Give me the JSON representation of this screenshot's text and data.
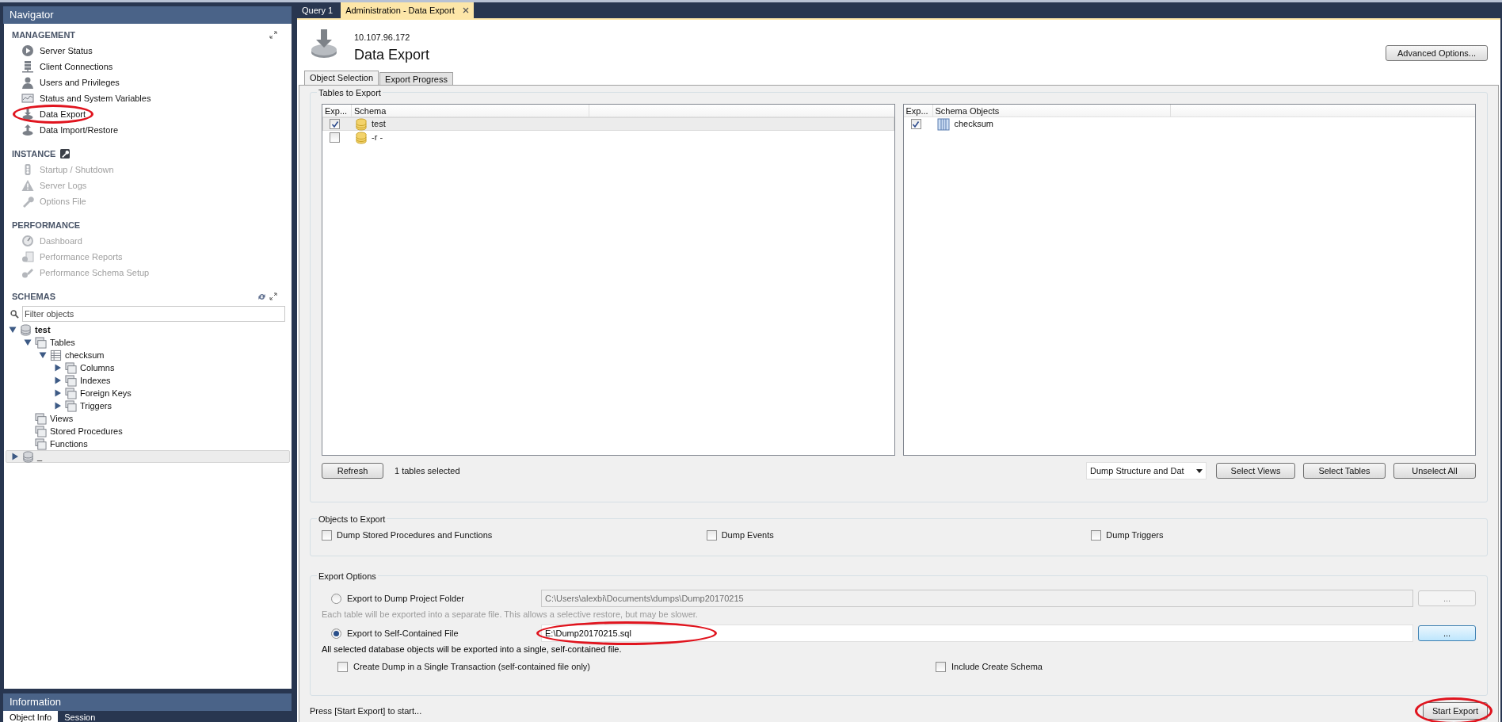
{
  "navigator": {
    "title": "Navigator",
    "sections": [
      {
        "heading": "MANAGEMENT",
        "items": [
          {
            "label": "Server Status",
            "kind": "play",
            "disabled": false,
            "highlighted": false
          },
          {
            "label": "Client Connections",
            "kind": "server",
            "disabled": false,
            "highlighted": false
          },
          {
            "label": "Users and Privileges",
            "kind": "user",
            "disabled": false,
            "highlighted": false
          },
          {
            "label": "Status and System Variables",
            "kind": "monitor",
            "disabled": false,
            "highlighted": false
          },
          {
            "label": "Data Export",
            "kind": "export",
            "disabled": false,
            "highlighted": true
          },
          {
            "label": "Data Import/Restore",
            "kind": "import",
            "disabled": false,
            "highlighted": false
          }
        ]
      },
      {
        "heading": "INSTANCE",
        "items": [
          {
            "label": "Startup / Shutdown",
            "kind": "traffic",
            "disabled": true,
            "highlighted": false
          },
          {
            "label": "Server Logs",
            "kind": "warning",
            "disabled": true,
            "highlighted": false
          },
          {
            "label": "Options File",
            "kind": "wrench",
            "disabled": true,
            "highlighted": false
          }
        ]
      },
      {
        "heading": "PERFORMANCE",
        "items": [
          {
            "label": "Dashboard",
            "kind": "gauge",
            "disabled": true,
            "highlighted": false
          },
          {
            "label": "Performance Reports",
            "kind": "reports",
            "disabled": true,
            "highlighted": false
          },
          {
            "label": "Performance Schema Setup",
            "kind": "tools",
            "disabled": true,
            "highlighted": false
          }
        ]
      }
    ]
  },
  "schemas": {
    "heading": "SCHEMAS",
    "filter": {
      "placeholder": "Filter objects"
    },
    "tree": [
      {
        "label": "test",
        "kind": "database",
        "expanded": true,
        "selected": false,
        "children": [
          {
            "label": "Tables",
            "kind": "folder",
            "expanded": true,
            "selected": false,
            "children": [
              {
                "label": "checksum",
                "kind": "table",
                "expanded": true,
                "selected": false,
                "children": [
                  {
                    "label": "Columns",
                    "kind": "folder",
                    "expanded": false,
                    "selected": false
                  },
                  {
                    "label": "Indexes",
                    "kind": "folder",
                    "expanded": false,
                    "selected": false
                  },
                  {
                    "label": "Foreign Keys",
                    "kind": "folder",
                    "expanded": false,
                    "selected": false
                  },
                  {
                    "label": "Triggers",
                    "kind": "folder",
                    "expanded": false,
                    "selected": false
                  }
                ]
              }
            ]
          },
          {
            "label": "Views",
            "kind": "folder",
            "selected": false
          },
          {
            "label": "Stored Procedures",
            "kind": "folder",
            "selected": false
          },
          {
            "label": "Functions",
            "kind": "folder",
            "selected": false
          }
        ]
      },
      {
        "label": "_",
        "kind": "database",
        "expanded": false,
        "selected": true
      }
    ]
  },
  "information": {
    "title": "Information",
    "tabs": [
      {
        "label": "Object Info",
        "selected": true
      },
      {
        "label": "Session",
        "selected": false
      }
    ]
  },
  "doc_tabs": [
    {
      "label": "Query 1",
      "selected": false,
      "closable": false
    },
    {
      "label": "Administration - Data Export",
      "selected": true,
      "closable": true
    }
  ],
  "header": {
    "host": "10.107.96.172",
    "title": "Data Export",
    "advanced_button": "Advanced Options..."
  },
  "sub_tabs": [
    {
      "label": "Object Selection",
      "selected": true
    },
    {
      "label": "Export Progress",
      "selected": false
    }
  ],
  "tables_to_export": {
    "title": "Tables to Export",
    "schema_list": {
      "columns": [
        "Exp...",
        "Schema"
      ],
      "rows": [
        {
          "checked": true,
          "name": "test",
          "selected": true
        },
        {
          "checked": false,
          "name": "-r -",
          "selected": false
        }
      ]
    },
    "objects_list": {
      "columns": [
        "Exp...",
        "Schema Objects"
      ],
      "rows": [
        {
          "checked": true,
          "name": "checksum",
          "selected": false
        }
      ]
    },
    "refresh_button": "Refresh",
    "selection_count": "1 tables selected",
    "dump_mode": "Dump Structure and Dat",
    "buttons": [
      "Select Views",
      "Select Tables",
      "Unselect All"
    ]
  },
  "objects_to_export": {
    "title": "Objects to Export",
    "options": [
      {
        "label": "Dump Stored Procedures and Functions",
        "checked": false
      },
      {
        "label": "Dump Events",
        "checked": false
      },
      {
        "label": "Dump Triggers",
        "checked": false
      }
    ]
  },
  "export_options": {
    "title": "Export Options",
    "destinations": [
      {
        "label": "Export to Dump Project Folder",
        "selected": false,
        "path": "C:\\Users\\alexbi\\Documents\\dumps\\Dump20170215",
        "browse": "...",
        "note": "Each table will be exported into a separate file. This allows a selective restore, but may be slower.",
        "highlighted": false
      },
      {
        "label": "Export to Self-Contained File",
        "selected": true,
        "path": "E:\\Dump20170215.sql",
        "browse": "...",
        "note": "All selected database objects will be exported into a single, self-contained file.",
        "highlighted": true
      }
    ],
    "options": [
      {
        "label": "Create Dump in a Single Transaction (self-contained file only)",
        "checked": false
      },
      {
        "label": "Include Create Schema",
        "checked": false
      }
    ]
  },
  "footer": {
    "status": "Press [Start Export] to start...",
    "start_button": "Start Export",
    "start_highlighted": true
  }
}
